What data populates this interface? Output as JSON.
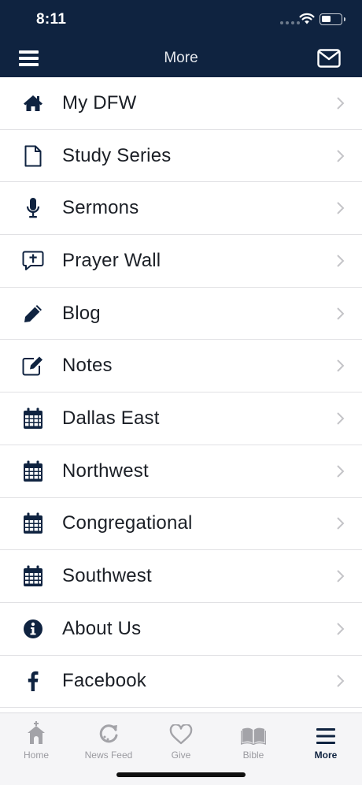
{
  "status_bar": {
    "time": "8:11"
  },
  "nav": {
    "title": "More"
  },
  "menu": [
    {
      "label": "My DFW",
      "icon": "home-icon"
    },
    {
      "label": "Study Series",
      "icon": "document-icon"
    },
    {
      "label": "Sermons",
      "icon": "microphone-icon"
    },
    {
      "label": "Prayer Wall",
      "icon": "prayer-bubble-icon"
    },
    {
      "label": "Blog",
      "icon": "pencil-icon"
    },
    {
      "label": "Notes",
      "icon": "edit-icon"
    },
    {
      "label": "Dallas East",
      "icon": "calendar-icon"
    },
    {
      "label": "Northwest",
      "icon": "calendar-icon"
    },
    {
      "label": "Congregational",
      "icon": "calendar-icon"
    },
    {
      "label": "Southwest",
      "icon": "calendar-icon"
    },
    {
      "label": "About Us",
      "icon": "info-icon"
    },
    {
      "label": "Facebook",
      "icon": "facebook-icon"
    }
  ],
  "tabs": [
    {
      "label": "Home",
      "icon": "church-icon"
    },
    {
      "label": "News Feed",
      "icon": "refresh-icon"
    },
    {
      "label": "Give",
      "icon": "heart-icon"
    },
    {
      "label": "Bible",
      "icon": "book-icon"
    },
    {
      "label": "More",
      "icon": "menu-icon",
      "active": true
    }
  ],
  "colors": {
    "header": "#0f2340",
    "icon": "#0f2340",
    "text": "#1b1f26",
    "inactive_tab": "#9a9aa0"
  }
}
